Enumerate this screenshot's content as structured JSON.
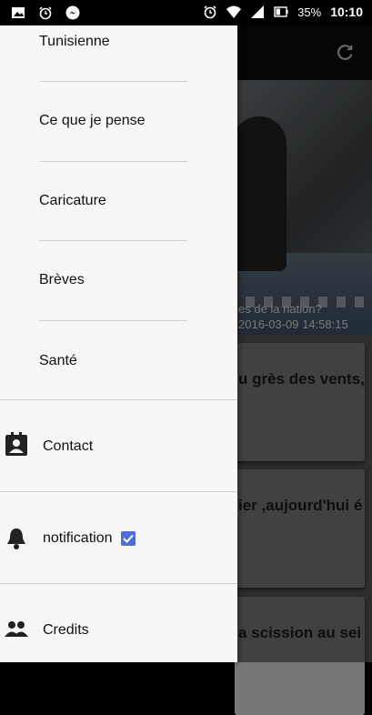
{
  "status_bar": {
    "battery": "35%",
    "time": "10:10"
  },
  "background": {
    "hero_caption_line1": "es de la nation?",
    "hero_caption_line2": "2016-03-09 14:58:15",
    "cards": [
      "u grès des vents,",
      "ier ,aujourd'hui é",
      "a scission au sei"
    ]
  },
  "drawer": {
    "partial_top_item": "Tunisienne",
    "categories": [
      "Ce que je pense",
      "Caricature",
      "Brèves",
      "Santé"
    ],
    "rows": {
      "contact": "Contact",
      "notification": "notification",
      "credits": "Credits"
    },
    "notification_checked": true,
    "accent_color": "#4f6fd6"
  }
}
